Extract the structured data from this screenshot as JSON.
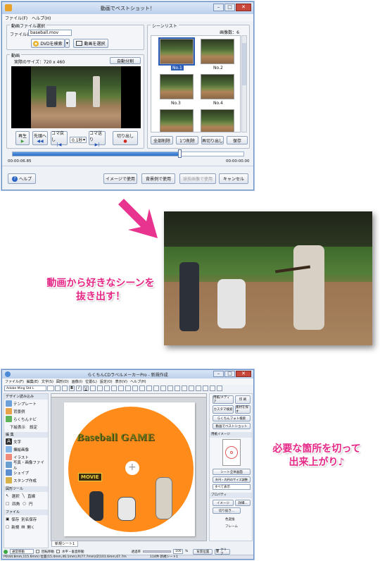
{
  "top_window": {
    "title": "動画でベストショット！",
    "menu": [
      "ファイル(F)",
      "ヘルプ(H)"
    ],
    "video_file_group": "動画ファイル選択",
    "file_name_label": "ファイル名",
    "file_name_value": "baseball.mov",
    "dvd_button": "DVDを検索",
    "select_video_button": "動画を選択",
    "video_group": "動画",
    "actual_size": "実際のサイズ：720 x 460",
    "auto_split_button": "自動分割",
    "controls": {
      "play": "再生",
      "to_start": "先頭へ",
      "frame_back": "コマ戻し",
      "speed": "0.1秒",
      "frame_forward": "コマ送り",
      "cut_out": "切り出し"
    },
    "time_start": "00:00:06.85",
    "time_end": "00:00:00.00",
    "progress_fraction": 0.72,
    "scene_list_group": "シーンリスト",
    "image_count": "画像数：6",
    "scene_labels": [
      "No.1",
      "No.2",
      "No.3",
      "No.4",
      "",
      ""
    ],
    "scene_buttons": [
      "全部削除",
      "1つ削除",
      "再切り出し",
      "保存"
    ],
    "help_button": "ヘルプ",
    "bottom_buttons": [
      "イメージで使用",
      "背景例で使用",
      "球技画像で使用",
      "キャンセル"
    ]
  },
  "callout_left": [
    "動画から好きなシーンを",
    "抜き出す！"
  ],
  "callout_right": [
    "必要な箇所を切って",
    "出来上がり♪"
  ],
  "bottom_window": {
    "title": "らくちんCDラベルメーカーPro - 新規作成",
    "menu": [
      "ファイル(F)",
      "編集(E)",
      "文字(S)",
      "図形(D)",
      "画像(I)",
      "位置(L)",
      "設定(O)",
      "表示(V)",
      "ヘルプ(H)"
    ],
    "font_name": "Adobe Ming Std L",
    "left_panel": {
      "design_section": "デザイン読み込み",
      "design_items": [
        "テンプレート",
        "背景例",
        "らくちんナビ"
      ],
      "design_footer": [
        "下絵表示",
        "設定"
      ],
      "edit_section": "編 集",
      "edit_items": [
        "文字",
        "挿絵画像",
        "イラスト",
        "写真・画像ファイル",
        "シェイプ",
        "スタンプ作成"
      ],
      "shape_tool_section": "図形ツール",
      "shape_tools": [
        "選択",
        "直線",
        "四角",
        "円"
      ],
      "file_section": "ファイル",
      "file_items": [
        "保存",
        "別名保存",
        "新規",
        "開く"
      ]
    },
    "canvas": {
      "disc_title": "Baseball GAME",
      "movie_tag": "MOVIE",
      "disc_color": "#ff8c1a"
    },
    "sheet_tab": "新規シート1",
    "right_panel": {
      "buttons": [
        "用紙/メディア",
        "印 刷",
        "カスタマ検索",
        "素材を探す",
        "らくちんフォト検索",
        "動画でベストショット"
      ],
      "paper_image_section": "用紙イメージ",
      "sheet_buttons": [
        "シート全体画面",
        "外円・内円のサイズ調整"
      ],
      "size_select": "すべて表示",
      "property_section": "プロパティ",
      "prop_buttons": [
        "イメージ",
        "詳細...",
        "切り抜き...",
        "色変換",
        "フレーム"
      ]
    },
    "bottom_left_select": "通常移動",
    "checkbox_labels": [
      "回転移動",
      "水平・垂直移動"
    ],
    "zoom_label": "透過率",
    "zoom_value": "100",
    "zoom_unit": "%",
    "settings_button": "背景位置",
    "clear_button": "クリア",
    "status_pos": "P0(44.8mm,115.6mm) 位置(15.4mm,46.1mm),R(77.7mm)/Z(101.6mm,67.7m",
    "status_count": "114件 新規シート1"
  }
}
